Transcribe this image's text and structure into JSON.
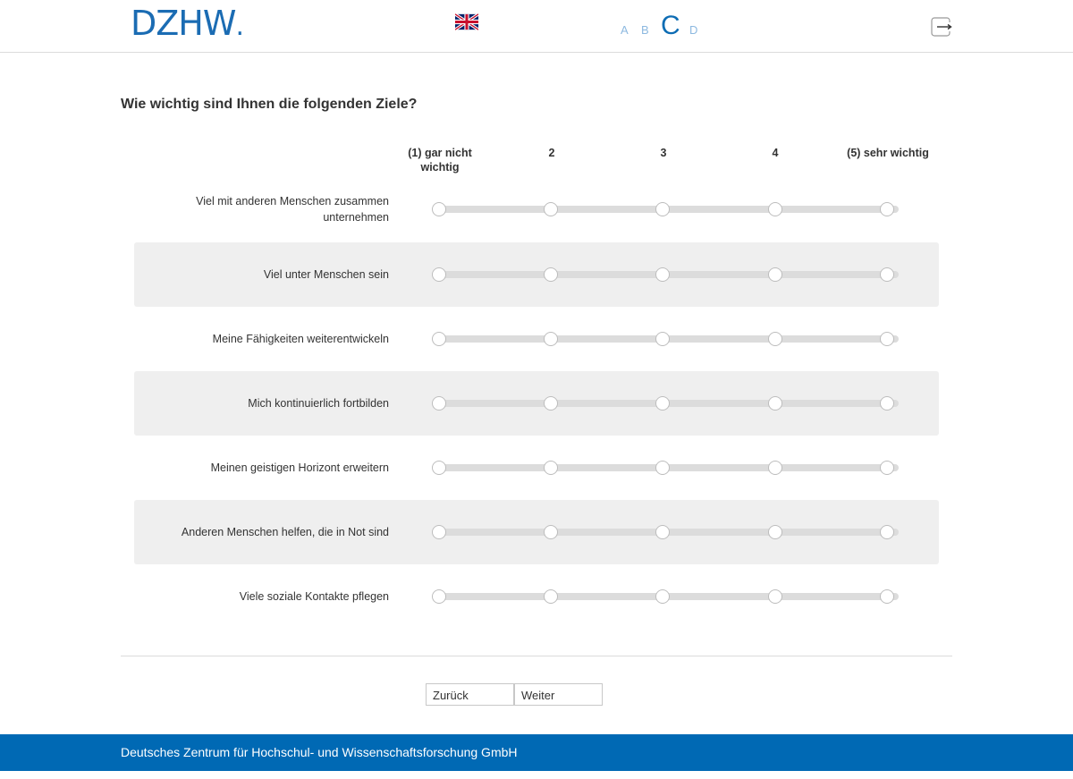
{
  "header": {
    "logo_text": "DZHW",
    "logo_dot": ".",
    "language_flag": "uk-flag-icon",
    "font_size_options": [
      "A",
      "B",
      "C",
      "D"
    ],
    "font_size_selected": "C",
    "logout_icon": "logout-icon"
  },
  "question": {
    "title": "Wie wichtig sind Ihnen die folgenden Ziele?",
    "scale": [
      "(1) gar nicht wichtig",
      "2",
      "3",
      "4",
      "(5) sehr wichtig"
    ],
    "items": [
      "Viel mit anderen Menschen zusammen unternehmen",
      "Viel unter Menschen sein",
      "Meine Fähigkeiten weiterentwickeln",
      "Mich kontinuierlich fortbilden",
      "Meinen geistigen Horizont erweitern",
      "Anderen Menschen helfen, die in Not sind",
      "Viele soziale Kontakte pflegen"
    ]
  },
  "navigation": {
    "back_label": "Zurück",
    "next_label": "Weiter"
  },
  "footer": {
    "text": "Deutsches Zentrum für Hochschul- und Wissenschaftsforschung GmbH"
  },
  "colors": {
    "brand": "#1b6cb3",
    "footer_bg": "#0069b4",
    "row_shade": "#efefef"
  }
}
